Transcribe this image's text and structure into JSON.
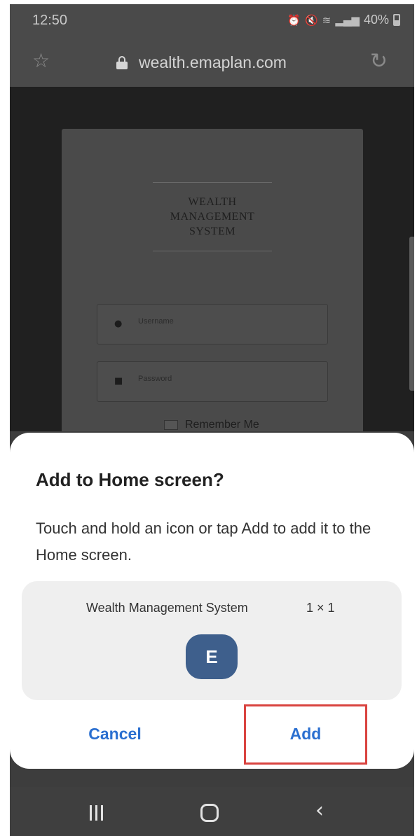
{
  "status_bar": {
    "time": "12:50",
    "indicator_icons": [
      "alarm-icon",
      "mute-icon",
      "wifi-icon",
      "signal-icon"
    ],
    "battery": "40%"
  },
  "browser": {
    "url": "wealth.emaplan.com",
    "icons": [
      "star-icon",
      "lock-icon",
      "reload-icon"
    ]
  },
  "login_page": {
    "logo_lines": [
      "WEALTH",
      "MANAGEMENT",
      "SYSTEM"
    ],
    "username_placeholder": "Username",
    "password_placeholder": "Password",
    "remember_label": "Remember Me"
  },
  "dialog": {
    "title": "Add to Home screen?",
    "body": "Touch and hold an icon or tap Add to add it to the Home screen.",
    "app_name": "Wealth Management System",
    "app_size": "1 × 1",
    "app_icon_letter": "E",
    "cancel_label": "Cancel",
    "add_label": "Add"
  },
  "colors": {
    "accent": "#2a6fd0",
    "app_icon_bg": "#3e5f8c",
    "highlight": "#d9433f"
  },
  "nav_bar": {
    "icons": [
      "recents-icon",
      "home-icon",
      "back-icon"
    ]
  }
}
